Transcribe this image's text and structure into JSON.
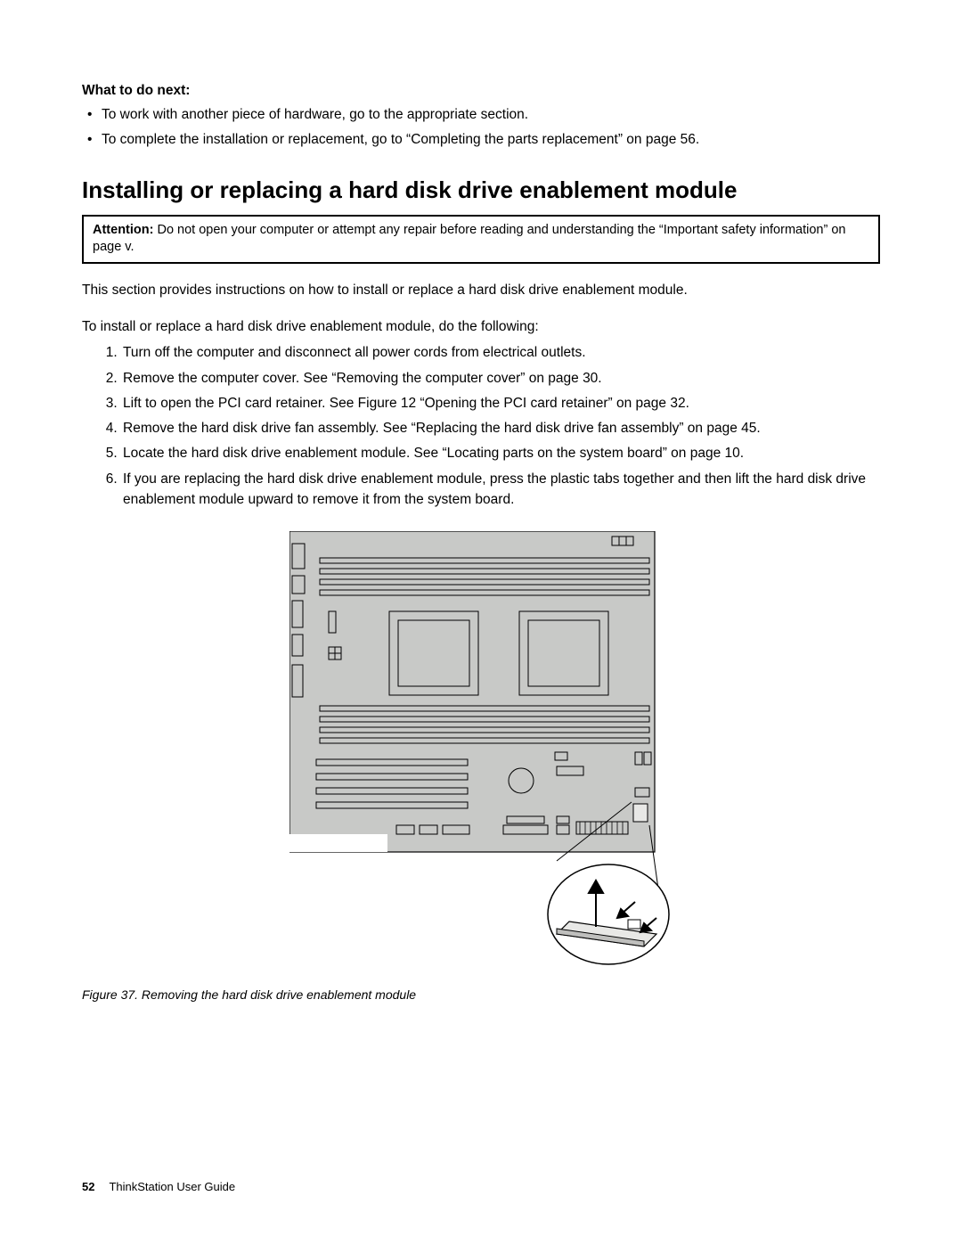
{
  "whatNext": {
    "heading": "What to do next:",
    "items": [
      "To work with another piece of hardware, go to the appropriate section.",
      "To complete the installation or replacement, go to “Completing the parts replacement” on page 56."
    ]
  },
  "section": {
    "heading": "Installing or replacing a hard disk drive enablement module",
    "attentionLabel": "Attention:",
    "attentionText": " Do not open your computer or attempt any repair before reading and understanding the “Important safety information” on page v.",
    "intro": "This section provides instructions on how to install or replace a hard disk drive enablement module.",
    "lead": "To install or replace a hard disk drive enablement module, do the following:",
    "steps": [
      "Turn off the computer and disconnect all power cords from electrical outlets.",
      "Remove the computer cover. See “Removing the computer cover” on page 30.",
      "Lift to open the PCI card retainer. See Figure 12 “Opening the PCI card retainer” on page 32.",
      "Remove the hard disk drive fan assembly. See “Replacing the hard disk drive fan assembly” on page 45.",
      "Locate the hard disk drive enablement module. See “Locating parts on the system board” on page 10.",
      "If you are replacing the hard disk drive enablement module, press the plastic tabs together and then lift the hard disk drive enablement module upward to remove it from the system board."
    ]
  },
  "figure": {
    "caption": "Figure 37.  Removing the hard disk drive enablement module"
  },
  "footer": {
    "pageNumber": "52",
    "docTitle": "ThinkStation User Guide"
  }
}
